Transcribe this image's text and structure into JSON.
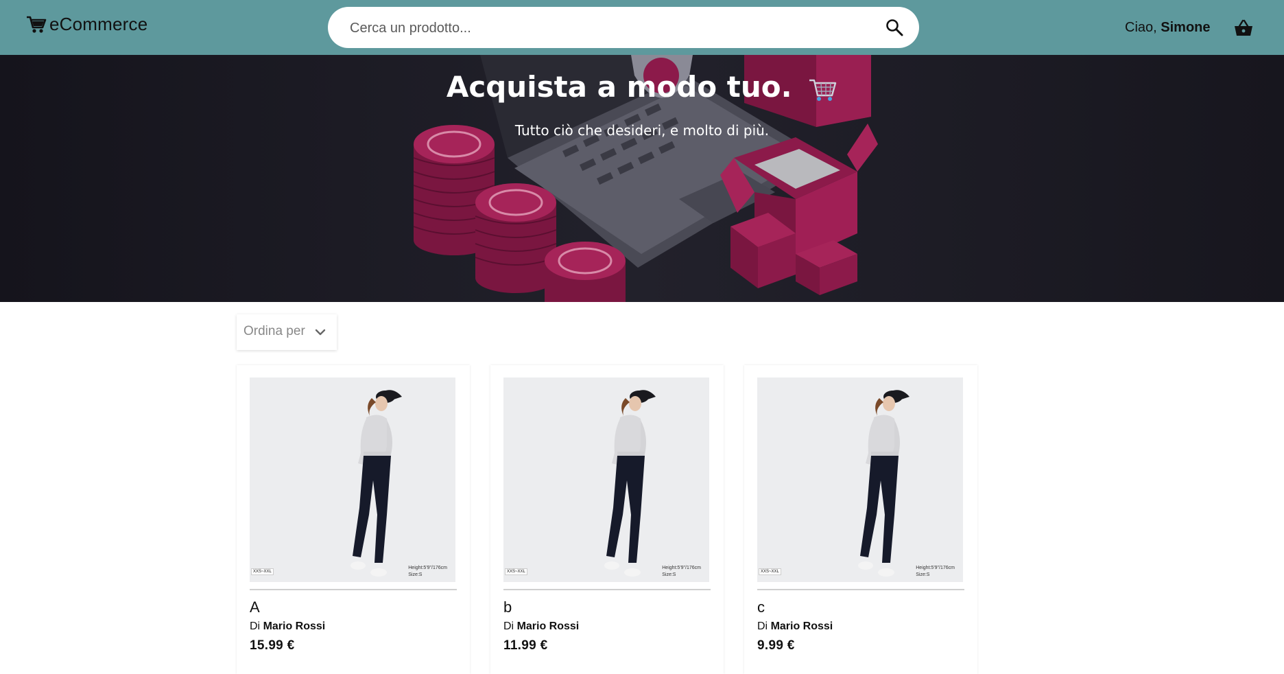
{
  "header": {
    "logo_text": "eCommerce",
    "search_placeholder": "Cerca un prodotto...",
    "greeting_prefix": "Ciao,",
    "user_name": "Simone",
    "bg_color": "#5e999d",
    "icons": {
      "logo": "shopping-cart-icon",
      "search": "search-icon",
      "basket": "basket-icon"
    }
  },
  "hero": {
    "title": "Acquista a modo tuo.",
    "subtitle": "Tutto ciò che desideri, e molto di più.",
    "accent_color": "#8c1a4a"
  },
  "sort": {
    "label": "Ordina per",
    "icon": "chevron-down-icon"
  },
  "products": [
    {
      "name": "A",
      "by_prefix": "Di",
      "seller": "Mario Rossi",
      "price": "15.99 €",
      "tag": "XXS~XXL",
      "info_line1": "Height:5'9\"/176cm",
      "info_line2": "Size:S"
    },
    {
      "name": "b",
      "by_prefix": "Di",
      "seller": "Mario Rossi",
      "price": "11.99 €",
      "tag": "XXS~XXL",
      "info_line1": "Height:5'9\"/176cm",
      "info_line2": "Size:S"
    },
    {
      "name": "c",
      "by_prefix": "Di",
      "seller": "Mario Rossi",
      "price": "9.99 €",
      "tag": "XXS~XXL",
      "info_line1": "Height:5'9\"/176cm",
      "info_line2": "Size:S"
    }
  ]
}
